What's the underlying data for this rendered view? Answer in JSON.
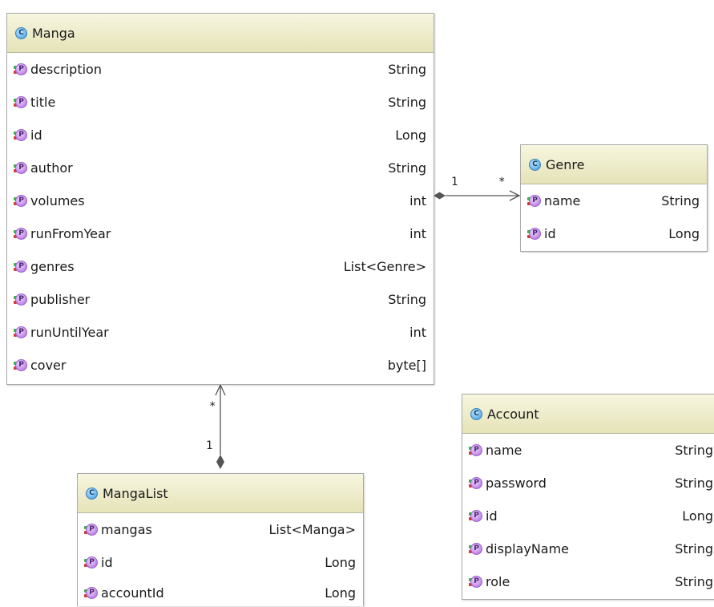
{
  "classes": {
    "manga": {
      "name": "Manga",
      "properties": [
        {
          "name": "description",
          "type": "String"
        },
        {
          "name": "title",
          "type": "String"
        },
        {
          "name": "id",
          "type": "Long"
        },
        {
          "name": "author",
          "type": "String"
        },
        {
          "name": "volumes",
          "type": "int"
        },
        {
          "name": "runFromYear",
          "type": "int"
        },
        {
          "name": "genres",
          "type": "List<Genre>"
        },
        {
          "name": "publisher",
          "type": "String"
        },
        {
          "name": "runUntilYear",
          "type": "int"
        },
        {
          "name": "cover",
          "type": "byte[]"
        }
      ]
    },
    "genre": {
      "name": "Genre",
      "properties": [
        {
          "name": "name",
          "type": "String"
        },
        {
          "name": "id",
          "type": "Long"
        }
      ]
    },
    "mangalist": {
      "name": "MangaList",
      "properties": [
        {
          "name": "mangas",
          "type": "List<Manga>"
        },
        {
          "name": "id",
          "type": "Long"
        },
        {
          "name": "accountId",
          "type": "Long"
        }
      ]
    },
    "account": {
      "name": "Account",
      "properties": [
        {
          "name": "name",
          "type": "String"
        },
        {
          "name": "password",
          "type": "String"
        },
        {
          "name": "id",
          "type": "Long"
        },
        {
          "name": "displayName",
          "type": "String"
        },
        {
          "name": "role",
          "type": "String"
        }
      ]
    }
  },
  "associations": {
    "manga_genre": {
      "source_multiplicity": "1",
      "target_multiplicity": "*"
    },
    "mangalist_manga": {
      "source_multiplicity": "1",
      "target_multiplicity": "*"
    }
  },
  "icons": {
    "class_icon_letter": "C",
    "property_icon_letter": "P"
  },
  "colors": {
    "header_top": "#f7f6df",
    "header_bottom": "#e5e3b8",
    "border": "#a9a9a9",
    "class_icon": "#6cb6ec",
    "property_icon": "#c793ea",
    "connector": "#555555"
  }
}
